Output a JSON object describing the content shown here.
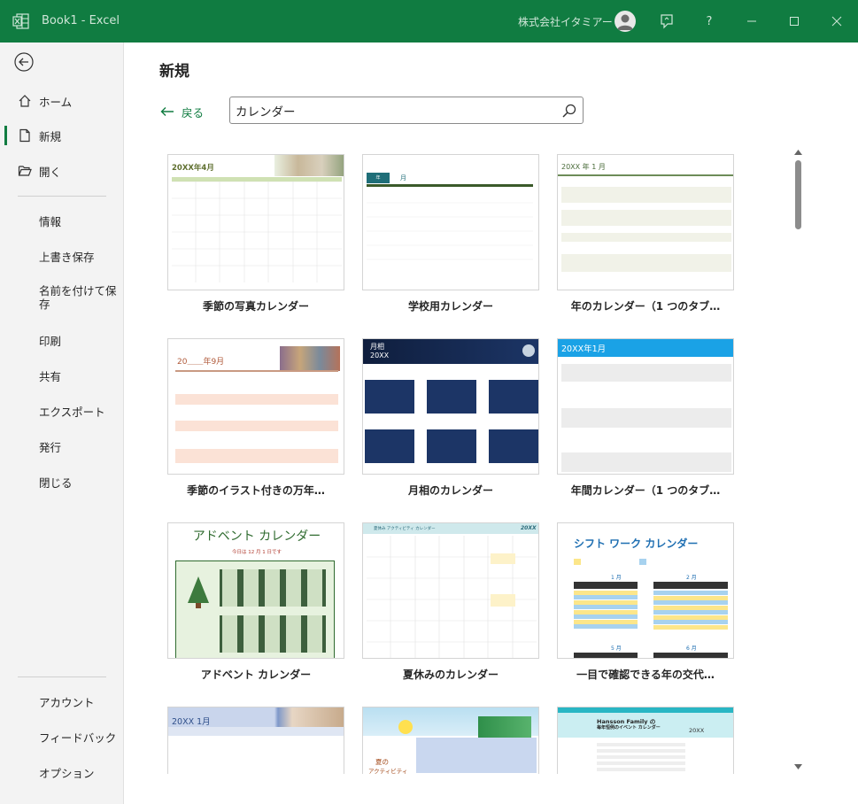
{
  "window": {
    "app_title": "Book1  -  Excel",
    "account_name": "株式会社イタミアート",
    "help_glyph": "?",
    "colors": {
      "brand": "#107c41",
      "sidebar_bg": "#f3f3f3"
    }
  },
  "sidebar": {
    "primary": [
      {
        "label": "ホーム",
        "icon": "home-icon"
      },
      {
        "label": "新規",
        "icon": "new-document-icon",
        "active": true
      },
      {
        "label": "開く",
        "icon": "open-folder-icon"
      }
    ],
    "secondary": [
      {
        "label": "情報"
      },
      {
        "label": "上書き保存"
      },
      {
        "label": "名前を付けて保存"
      },
      {
        "label": "印刷"
      },
      {
        "label": "共有"
      },
      {
        "label": "エクスポート"
      },
      {
        "label": "発行"
      },
      {
        "label": "閉じる"
      }
    ],
    "bottom": [
      {
        "label": "アカウント"
      },
      {
        "label": "フィードバック"
      },
      {
        "label": "オプション"
      }
    ]
  },
  "main": {
    "title": "新規",
    "back_label": "戻る",
    "search": {
      "value": "カレンダー",
      "placeholder": ""
    },
    "templates": [
      {
        "label": "季節の写真カレンダー",
        "thumb_title": "20XX年4月"
      },
      {
        "label": "学校用カレンダー",
        "thumb_title": "月",
        "thumb_badge": "年"
      },
      {
        "label": "年のカレンダー（1 つのタブ…",
        "thumb_title": "20XX 年 1 月"
      },
      {
        "label": "季節のイラスト付きの万年…",
        "thumb_title": "20＿＿年9月"
      },
      {
        "label": "月相のカレンダー",
        "thumb_title": "月相",
        "thumb_subtitle": "20XX"
      },
      {
        "label": "年間カレンダー（1 つのタブ…",
        "thumb_title": "20XX年1月"
      },
      {
        "label": "アドベント カレンダー",
        "thumb_title": "アドベント カレンダー",
        "thumb_subtitle": "今日は 12 月 1 日です"
      },
      {
        "label": "夏休みのカレンダー",
        "thumb_title": "夏休み アクティビティ カレンダー",
        "thumb_subtitle": "20XX"
      },
      {
        "label": "一目で確認できる年の交代…",
        "thumb_title": "シフト ワーク カレンダー",
        "months": [
          "1 月",
          "2 月",
          "5 月",
          "6 月"
        ]
      },
      {
        "label": "",
        "thumb_title": "20XX  1月"
      },
      {
        "label": "",
        "thumb_title": "夏の",
        "thumb_subtitle": "アクティビティ"
      },
      {
        "label": "",
        "thumb_title": "Hansson Family の",
        "thumb_subtitle": "毎年恒例のイベント カレンダー",
        "thumb_year": "20XX"
      }
    ]
  }
}
